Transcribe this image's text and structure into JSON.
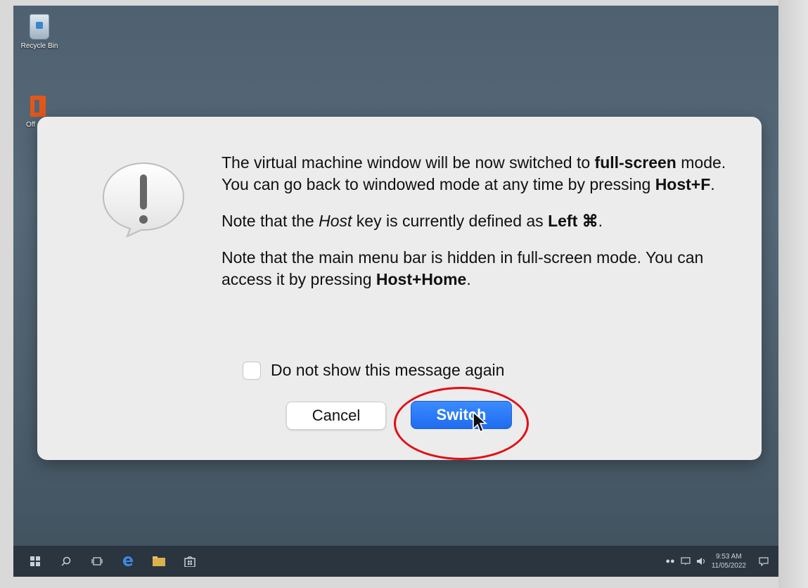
{
  "desktop": {
    "recycle_bin_label": "Recycle Bin",
    "office_label": "Off"
  },
  "dialog": {
    "paragraph1": {
      "part1": "The virtual machine window will be now switched to ",
      "bold1": "full-screen",
      "part2": " mode. You can go back to windowed mode at any time by pressing ",
      "bold2": "Host+F",
      "part3": "."
    },
    "paragraph2": {
      "part1": "Note that the ",
      "italic1": "Host",
      "part2": " key is currently defined as ",
      "bold1": "Left ⌘",
      "part3": "."
    },
    "paragraph3": {
      "part1": "Note that the main menu bar is hidden in full-screen mode. You can access it by pressing ",
      "bold1": "Host+Home",
      "part2": "."
    },
    "checkbox_label": "Do not show this message again",
    "checkbox_checked": false,
    "cancel_label": "Cancel",
    "switch_label": "Switch"
  },
  "taskbar": {
    "time": "9:53 AM",
    "date": "11/05/2022"
  },
  "colors": {
    "accent_button": "#1f6cf0",
    "highlight_ring": "#e10f16"
  }
}
